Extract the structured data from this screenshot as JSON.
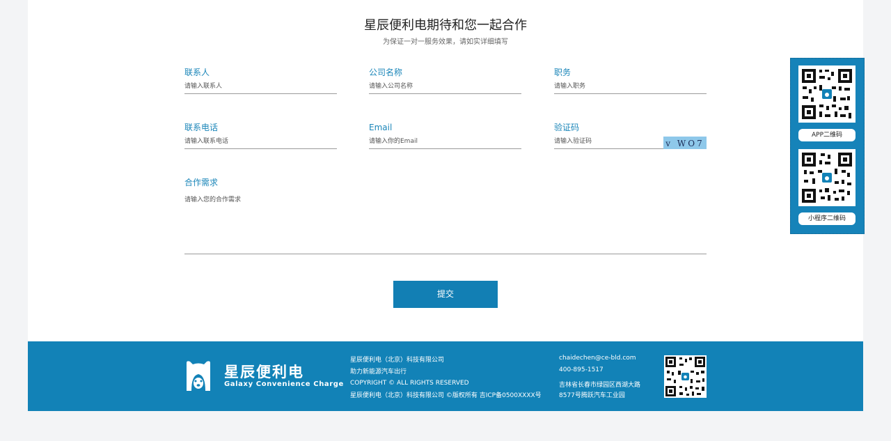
{
  "header": {
    "title": "星辰便利电期待和您一起合作",
    "subtitle": "为保证一对一服务效果，请如实详细填写"
  },
  "form": {
    "contact": {
      "label": "联系人",
      "placeholder": "请输入联系人"
    },
    "company": {
      "label": "公司名称",
      "placeholder": "请输入公司名称"
    },
    "position": {
      "label": "职务",
      "placeholder": "请输入职务"
    },
    "phone": {
      "label": "联系电话",
      "placeholder": "请输入联系电话"
    },
    "email": {
      "label": "Email",
      "placeholder": "请输入你的Email"
    },
    "captcha": {
      "label": "验证码",
      "placeholder": "请输入验证码",
      "code": "v WO7"
    },
    "needs": {
      "label": "合作需求",
      "placeholder": "请输入您的合作需求"
    },
    "submit_label": "提交"
  },
  "sidebar": {
    "app_qr_label": "APP二维码",
    "mini_qr_label": "小程序二维码"
  },
  "footer": {
    "brand_cn": "星辰便利电",
    "brand_en": "Galaxy Convenience Charge",
    "company": "星辰便利电（北京）科技有限公司",
    "slogan": "助力新能源汽车出行",
    "copyright": "COPYRIGHT © ALL RIGHTS RESERVED",
    "icp": "星辰便利电（北京）科技有限公司 ©版权所有 吉ICP备0500XXXX号",
    "email": "chaidechen@ce-bld.com",
    "phone": "400-895-1517",
    "address1": "吉林省长春市绿园区西湖大路",
    "address2": "8577号腾跃汽车工业园"
  },
  "colors": {
    "accent": "#1282b7",
    "label": "#1b86b9"
  }
}
